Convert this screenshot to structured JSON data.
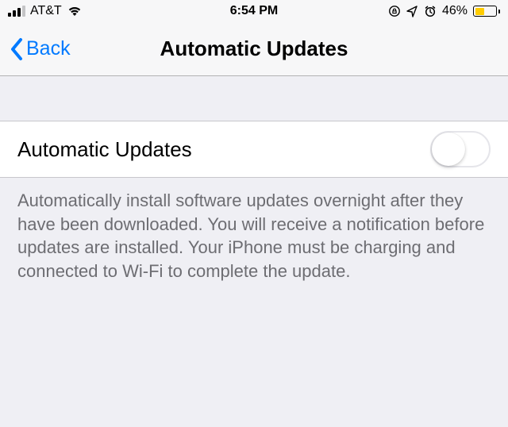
{
  "status_bar": {
    "carrier": "AT&T",
    "time": "6:54 PM",
    "battery_percent": "46%",
    "battery_level": 46,
    "signal_strength": 3,
    "battery_color": "#ffcc00"
  },
  "nav": {
    "back_label": "Back",
    "title": "Automatic Updates"
  },
  "setting": {
    "label": "Automatic Updates",
    "toggle_on": false
  },
  "footer": {
    "text": "Automatically install software updates overnight after they have been downloaded. You will receive a notification before updates are installed. Your iPhone must be charging and connected to Wi-Fi to complete the update."
  }
}
